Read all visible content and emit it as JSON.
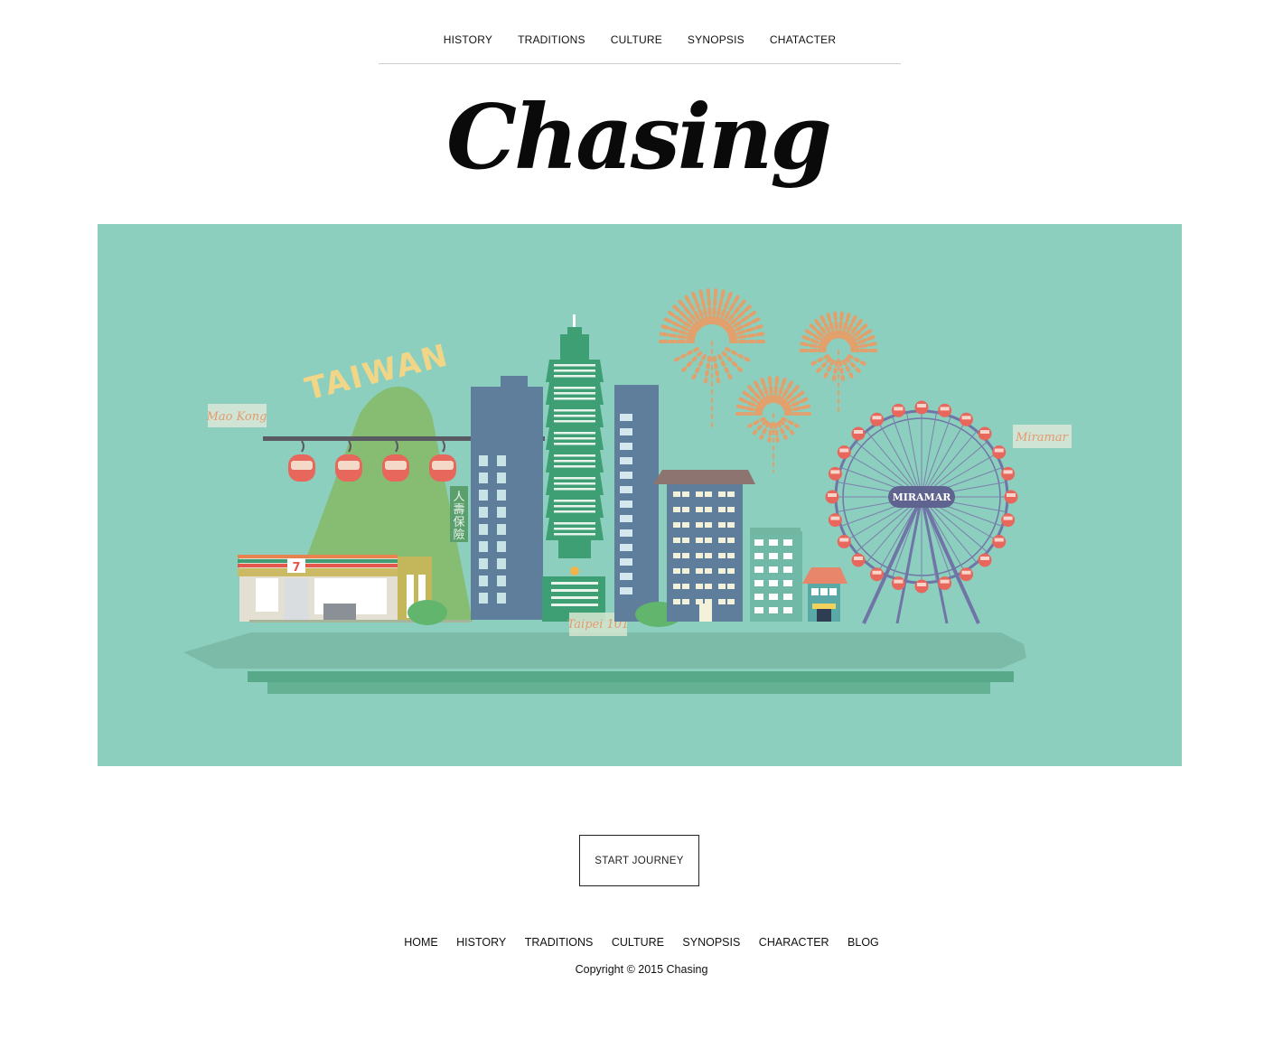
{
  "top_nav": {
    "items": [
      "HISTORY",
      "TRADITIONS",
      "CULTURE",
      "SYNOPSIS",
      "CHATACTER"
    ]
  },
  "logo": {
    "text": "Chasing"
  },
  "hero": {
    "mountain_text": "TAIWAN",
    "label_maokong": "Mao Kong",
    "label_taipei101": "Taipei 101",
    "label_miramar": "Miramar",
    "ferris_sign": "MIRAMAR",
    "vertical_sign": [
      "人",
      "壽",
      "保",
      "險"
    ],
    "colors": {
      "background": "#8ccfbe",
      "mountain": "#86bd73",
      "tower": "#3e9e74",
      "fireworks": "#e1a06c",
      "ferris": "#6f75a6",
      "gondola": "#e8675c"
    }
  },
  "cta": {
    "label": "START JOURNEY"
  },
  "footer": {
    "items": [
      "HOME",
      "HISTORY",
      "TRADITIONS",
      "CULTURE",
      "SYNOPSIS",
      "CHARACTER",
      "BLOG"
    ],
    "copyright": "Copyright © 2015 Chasing"
  }
}
